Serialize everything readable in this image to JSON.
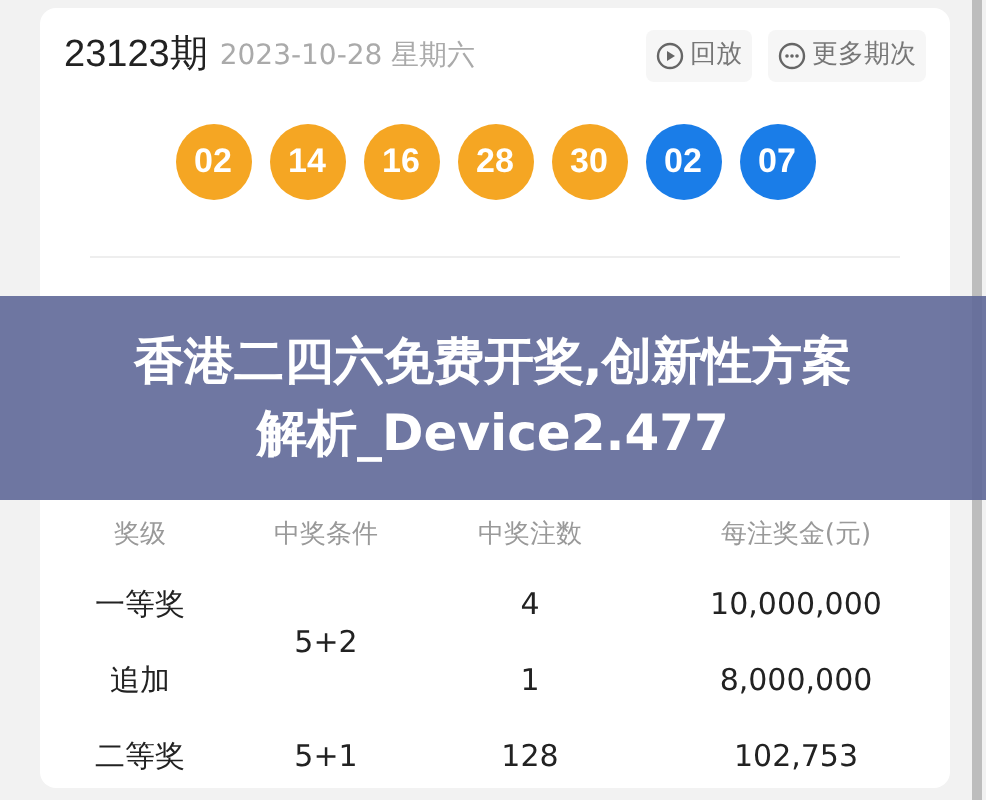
{
  "header": {
    "issue": "23123期",
    "date": "2023-10-28 星期六",
    "actions": [
      {
        "kind": "play",
        "label": "回放"
      },
      {
        "kind": "more",
        "label": "更多期次"
      }
    ]
  },
  "balls": [
    {
      "number": "02",
      "color": "#f5a623"
    },
    {
      "number": "14",
      "color": "#f5a623"
    },
    {
      "number": "16",
      "color": "#f5a623"
    },
    {
      "number": "28",
      "color": "#f5a623"
    },
    {
      "number": "30",
      "color": "#f5a623"
    },
    {
      "number": "02",
      "color": "#1a7de8"
    },
    {
      "number": "07",
      "color": "#1a7de8"
    }
  ],
  "overlay_title": "香港二四六免费开奖,创新性方案解析_Device2.477",
  "table": {
    "columns": [
      "奖级",
      "中奖条件",
      "中奖注数",
      "每注奖金(元)"
    ],
    "rows": [
      {
        "level": "一等奖",
        "condition": "5+2",
        "count": "4",
        "prize": "10,000,000"
      },
      {
        "level": "追加",
        "count": "1",
        "prize": "8,000,000"
      },
      {
        "level": "二等奖",
        "condition": "5+1",
        "count": "128",
        "prize": "102,753"
      }
    ]
  }
}
